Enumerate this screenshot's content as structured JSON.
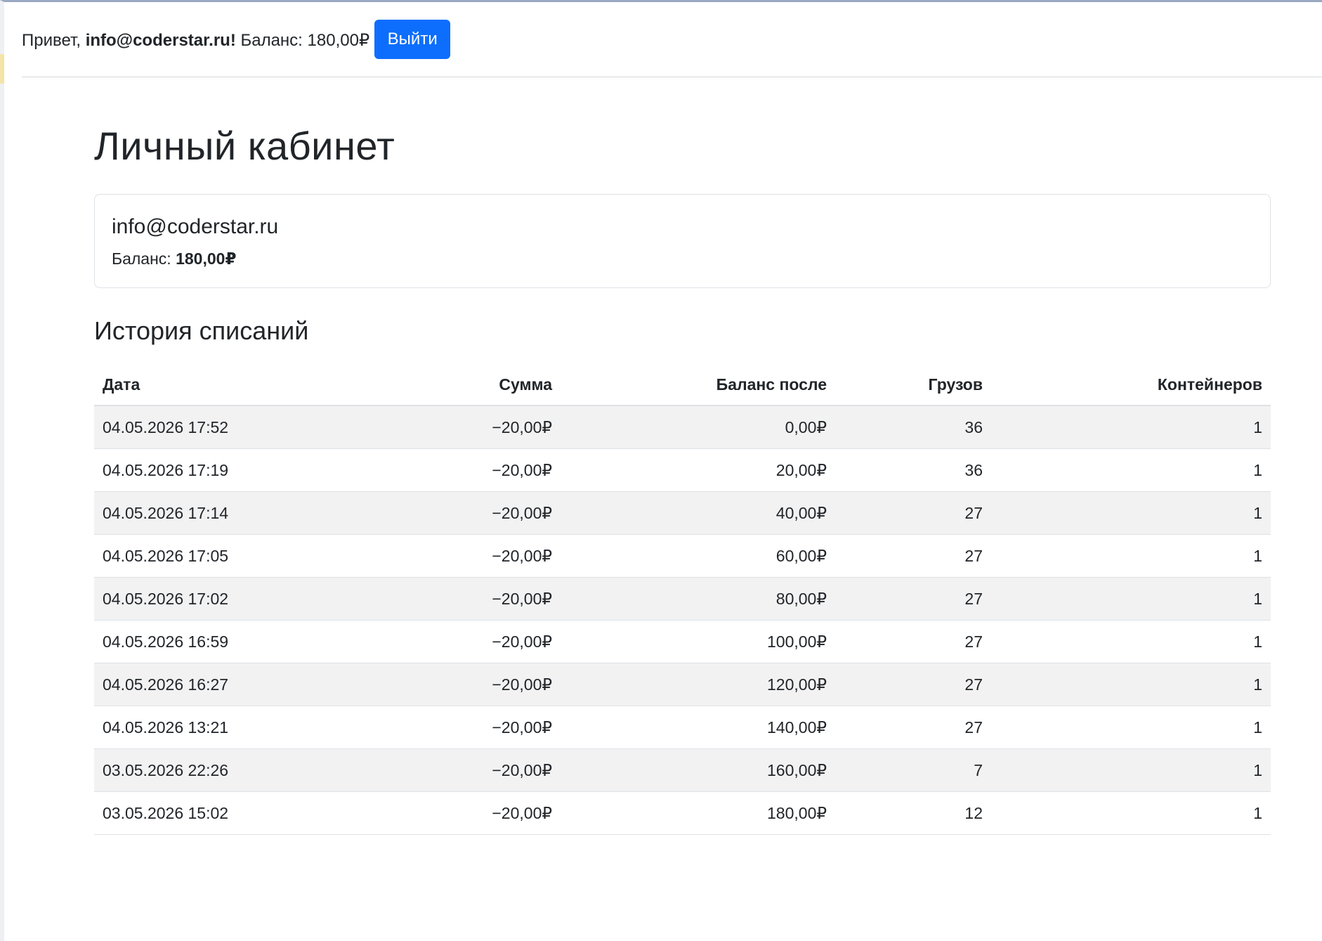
{
  "header": {
    "greeting_prefix": "Привет, ",
    "user_email": "info@coderstar.ru!",
    "balance_text": " Баланс: 180,00₽",
    "logout_label": "Выйти"
  },
  "page": {
    "title": "Личный кабинет"
  },
  "account_card": {
    "email": "info@coderstar.ru",
    "balance_label": "Баланс: ",
    "balance_value": "180,00₽"
  },
  "history": {
    "title": "История списаний",
    "columns": [
      "Дата",
      "Сумма",
      "Баланс после",
      "Грузов",
      "Контейнеров"
    ],
    "rows": [
      [
        "04.05.2026 17:52",
        "−20,00₽",
        "0,00₽",
        "36",
        "1"
      ],
      [
        "04.05.2026 17:19",
        "−20,00₽",
        "20,00₽",
        "36",
        "1"
      ],
      [
        "04.05.2026 17:14",
        "−20,00₽",
        "40,00₽",
        "27",
        "1"
      ],
      [
        "04.05.2026 17:05",
        "−20,00₽",
        "60,00₽",
        "27",
        "1"
      ],
      [
        "04.05.2026 17:02",
        "−20,00₽",
        "80,00₽",
        "27",
        "1"
      ],
      [
        "04.05.2026 16:59",
        "−20,00₽",
        "100,00₽",
        "27",
        "1"
      ],
      [
        "04.05.2026 16:27",
        "−20,00₽",
        "120,00₽",
        "27",
        "1"
      ],
      [
        "04.05.2026 13:21",
        "−20,00₽",
        "140,00₽",
        "27",
        "1"
      ],
      [
        "03.05.2026 22:26",
        "−20,00₽",
        "160,00₽",
        "7",
        "1"
      ],
      [
        "03.05.2026 15:02",
        "−20,00₽",
        "180,00₽",
        "12",
        "1"
      ]
    ]
  },
  "colors": {
    "accent": "#0d6efd",
    "text": "#212529",
    "row_stripe": "#f2f2f2",
    "border": "#dee2e6"
  }
}
